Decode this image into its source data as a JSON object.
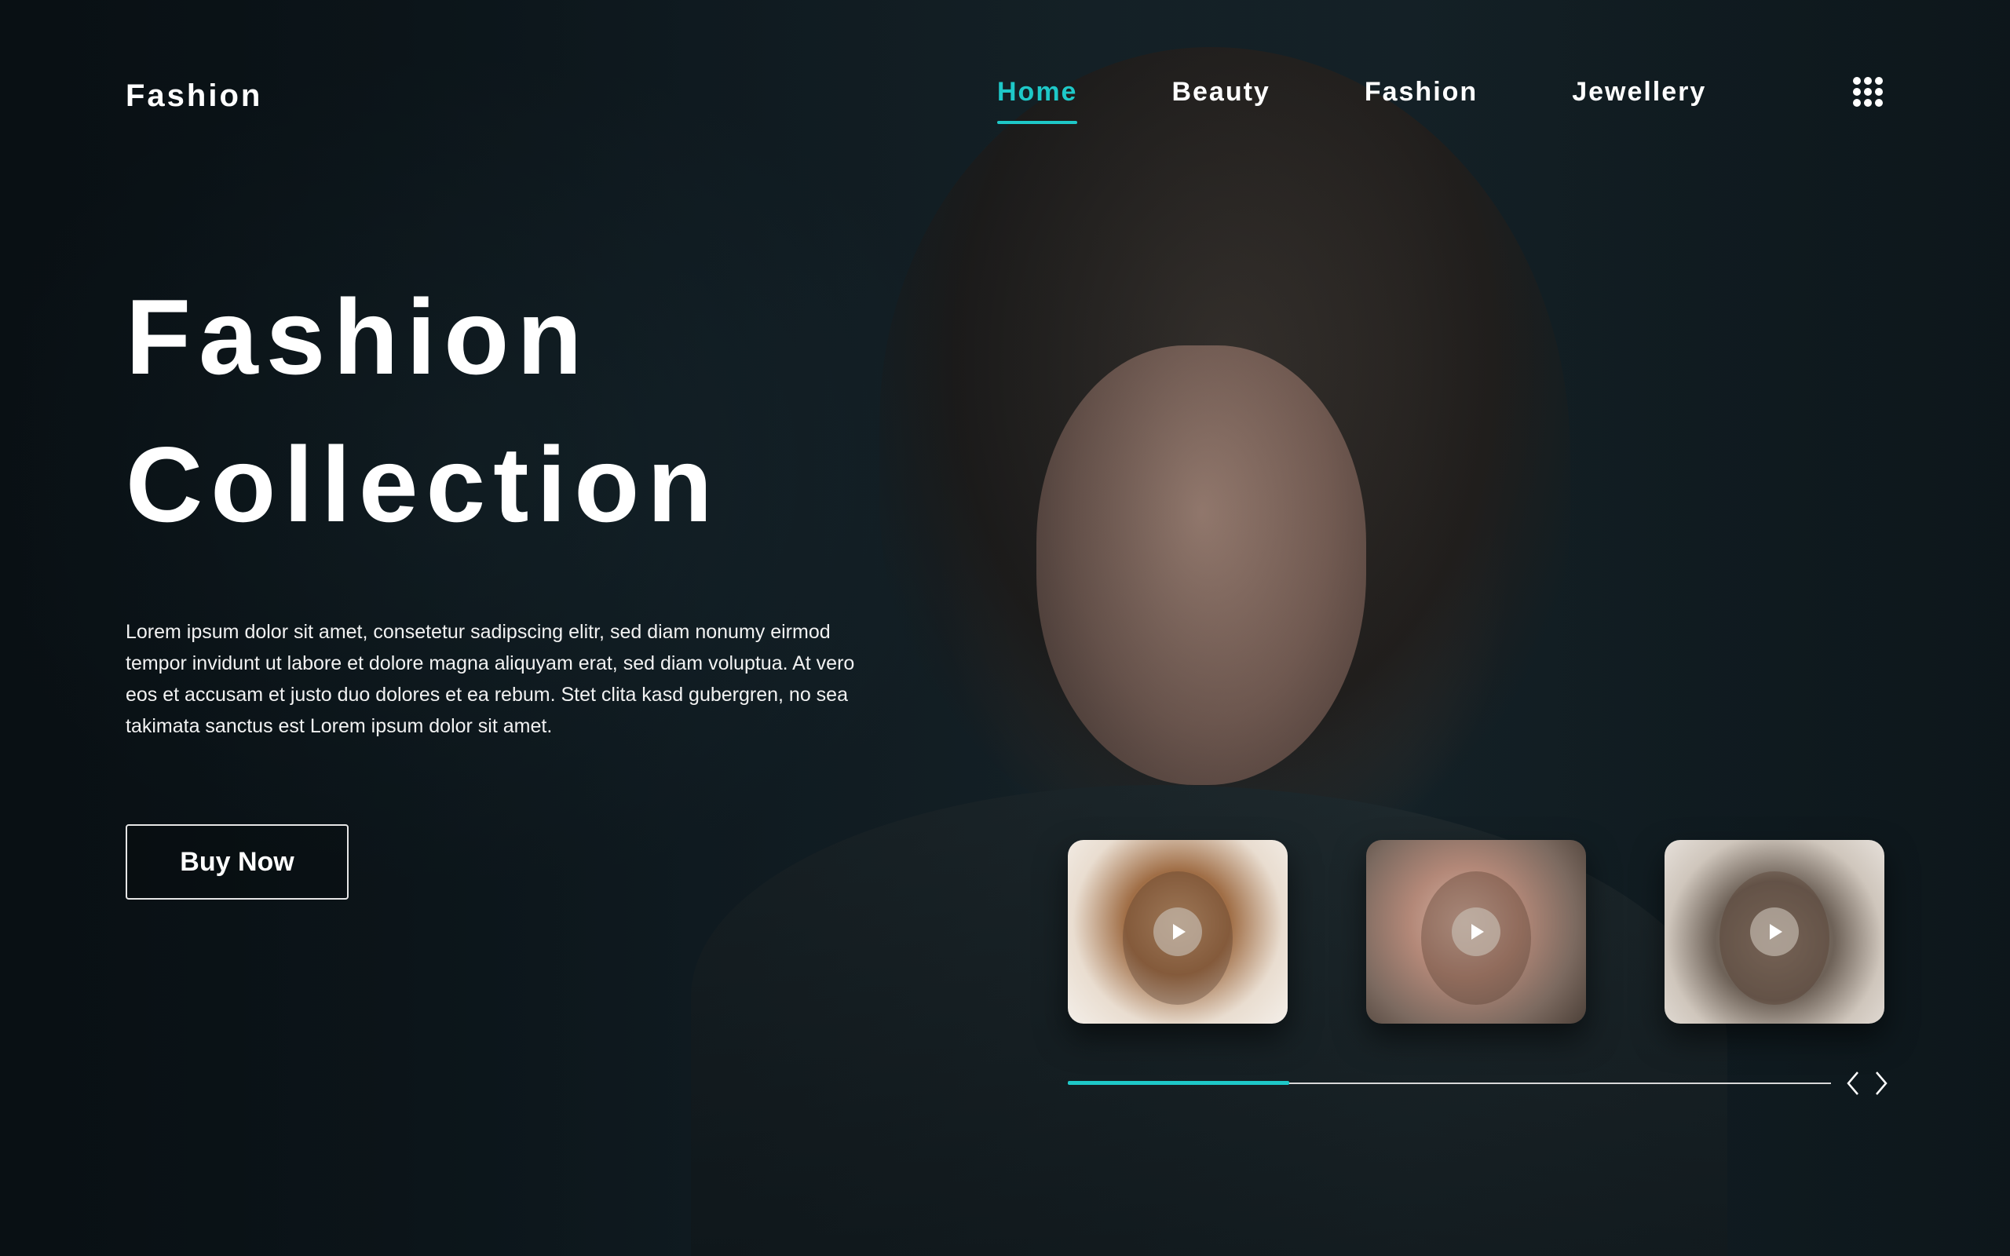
{
  "brand": {
    "name": "Fashion"
  },
  "nav": {
    "items": [
      {
        "label": "Home",
        "active": true
      },
      {
        "label": "Beauty",
        "active": false
      },
      {
        "label": "Fashion",
        "active": false
      },
      {
        "label": "Jewellery",
        "active": false
      }
    ],
    "menu_icon": "grid-dots-icon"
  },
  "hero": {
    "title_line1": "Fashion",
    "title_line2": "Collection",
    "description": "Lorem ipsum dolor sit amet, consetetur sadipscing elitr, sed diam nonumy eirmod tempor invidunt ut labore et dolore magna aliquyam erat, sed diam voluptua. At vero eos et accusam et justo duo dolores et ea rebum. Stet clita kasd gubergren, no sea takimata sanctus est Lorem ipsum dolor sit amet.",
    "buy_button_label": "Buy Now"
  },
  "carousel": {
    "thumbnails": [
      {
        "icon": "play-icon"
      },
      {
        "icon": "play-icon"
      },
      {
        "icon": "play-icon"
      }
    ],
    "progress_fraction": 0.29,
    "prev_icon": "chevron-left-icon",
    "next_icon": "chevron-right-icon"
  },
  "colors": {
    "accent": "#1ec8c8",
    "text": "#ffffff",
    "background": "#0e1920"
  }
}
